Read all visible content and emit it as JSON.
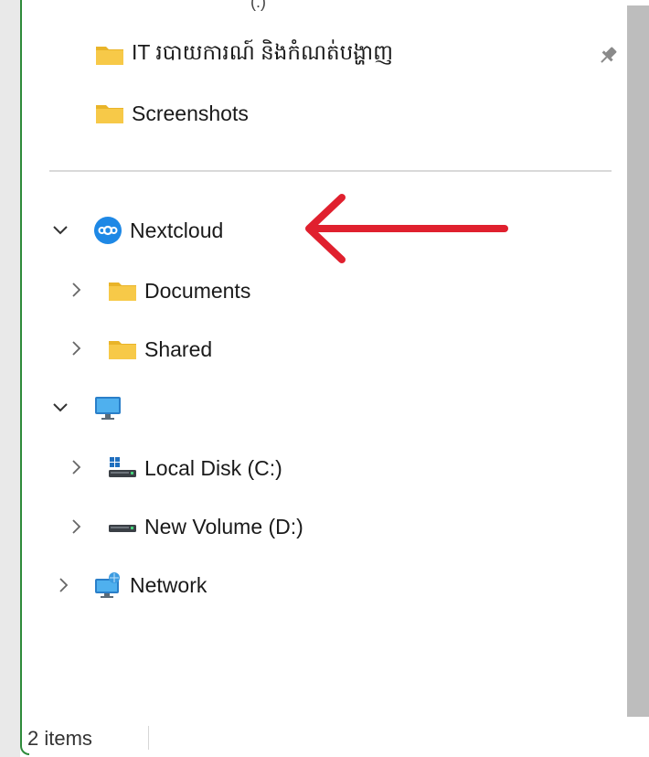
{
  "nav": {
    "cut_text": "(:)",
    "quick_access": [
      {
        "label": "IT របាយការណ៍ និងកំណត់បង្ហាញ",
        "pinned": true
      },
      {
        "label": "Screenshots",
        "pinned": false
      }
    ],
    "nextcloud": {
      "label": "Nextcloud",
      "expanded": true,
      "children": [
        {
          "label": "Documents"
        },
        {
          "label": "Shared"
        }
      ]
    },
    "this_pc": {
      "label": "",
      "expanded": true,
      "children": [
        {
          "label": "Local Disk (C:)"
        },
        {
          "label": "New Volume (D:)"
        }
      ]
    },
    "network": {
      "label": "Network",
      "expanded": false
    }
  },
  "status": {
    "items_text": "2 items"
  },
  "colors": {
    "accent_green": "#2e8b3a",
    "arrow_red": "#e0202e",
    "folder_yellow": "#f5c542",
    "nextcloud_blue": "#1e88e5"
  },
  "icons": {
    "folder": "folder-icon",
    "pin": "pin-icon",
    "nextcloud": "nextcloud-icon",
    "monitor": "monitor-icon",
    "drive": "drive-icon",
    "network": "network-icon",
    "chevron_down": "chevron-down-icon",
    "chevron_right": "chevron-right-icon"
  }
}
